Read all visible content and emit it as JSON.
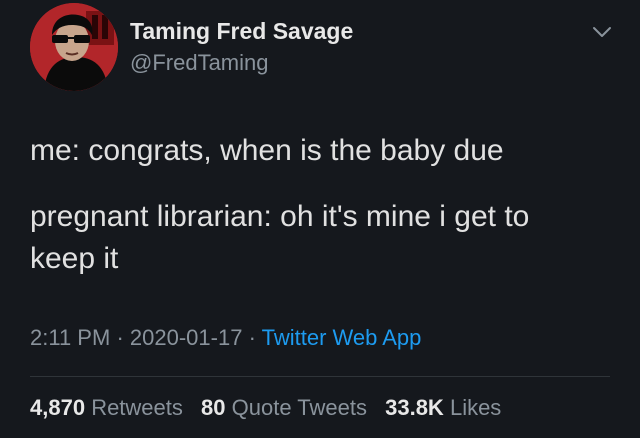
{
  "author": {
    "display_name": "Taming Fred Savage",
    "handle": "@FredTaming"
  },
  "tweet": {
    "lines": [
      "me: congrats, when is the baby due",
      "pregnant librarian: oh it's mine i get to",
      "keep it"
    ]
  },
  "meta": {
    "time": "2:11 PM",
    "separator": "·",
    "date": "2020-01-17",
    "source": "Twitter Web App"
  },
  "stats": {
    "retweets": {
      "count": "4,870",
      "label": "Retweets"
    },
    "quote_tweets": {
      "count": "80",
      "label": "Quote Tweets"
    },
    "likes": {
      "count": "33.8K",
      "label": "Likes"
    }
  },
  "icons": {
    "menu": "chevron-down-icon"
  },
  "colors": {
    "background": "#15181d",
    "link": "#1d9bf0",
    "avatar": "#b2262a"
  }
}
